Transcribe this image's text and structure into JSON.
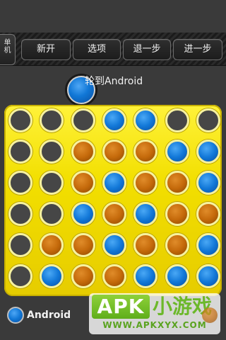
{
  "toolbar": {
    "side_tab": [
      "单",
      "机"
    ],
    "buttons": [
      "新开",
      "选项",
      "退一步",
      "进一步"
    ]
  },
  "status": {
    "text": "轮到Android"
  },
  "board": {
    "columns": 7,
    "rows": 6,
    "cells": [
      [
        "empty",
        "empty",
        "empty",
        "blue",
        "blue",
        "empty",
        "empty"
      ],
      [
        "empty",
        "empty",
        "orange",
        "orange",
        "orange",
        "blue",
        "blue"
      ],
      [
        "empty",
        "empty",
        "orange",
        "blue",
        "orange",
        "orange",
        "blue"
      ],
      [
        "empty",
        "empty",
        "blue",
        "orange",
        "blue",
        "orange",
        "orange"
      ],
      [
        "empty",
        "orange",
        "orange",
        "blue",
        "orange",
        "orange",
        "blue"
      ],
      [
        "empty",
        "blue",
        "orange",
        "orange",
        "blue",
        "blue",
        "blue"
      ]
    ],
    "colors": {
      "board": "#f2df00",
      "blue": "#1278d8",
      "orange": "#c56a0b",
      "empty": "#464646"
    }
  },
  "footer": {
    "player_label": "Android"
  },
  "watermark": {
    "logo": "APK",
    "logo_suffix": "小游戏",
    "url": "WWW.APKXYX.COM"
  }
}
